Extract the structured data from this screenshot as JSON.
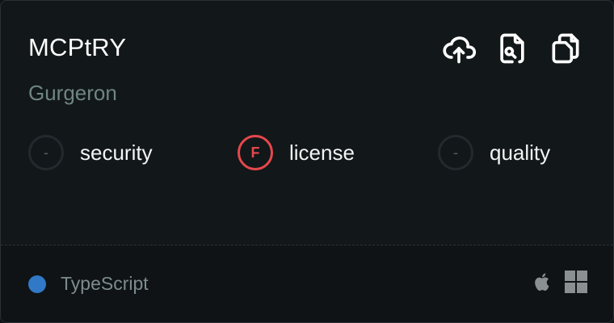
{
  "server": {
    "name": "MCPtRY",
    "author": "Gurgeron"
  },
  "actions": [
    {
      "icon": "cloud-upload-icon"
    },
    {
      "icon": "file-search-icon"
    },
    {
      "icon": "copy-icon"
    }
  ],
  "scores": [
    {
      "grade": "-",
      "label": "security"
    },
    {
      "grade": "F",
      "label": "license"
    },
    {
      "grade": "-",
      "label": "quality"
    }
  ],
  "footer": {
    "language": "TypeScript",
    "language_color": "#3178c6",
    "platforms": [
      "apple-icon",
      "windows-icon"
    ]
  },
  "colors": {
    "grade_f": "#e5484d",
    "muted": "#6f8581"
  }
}
